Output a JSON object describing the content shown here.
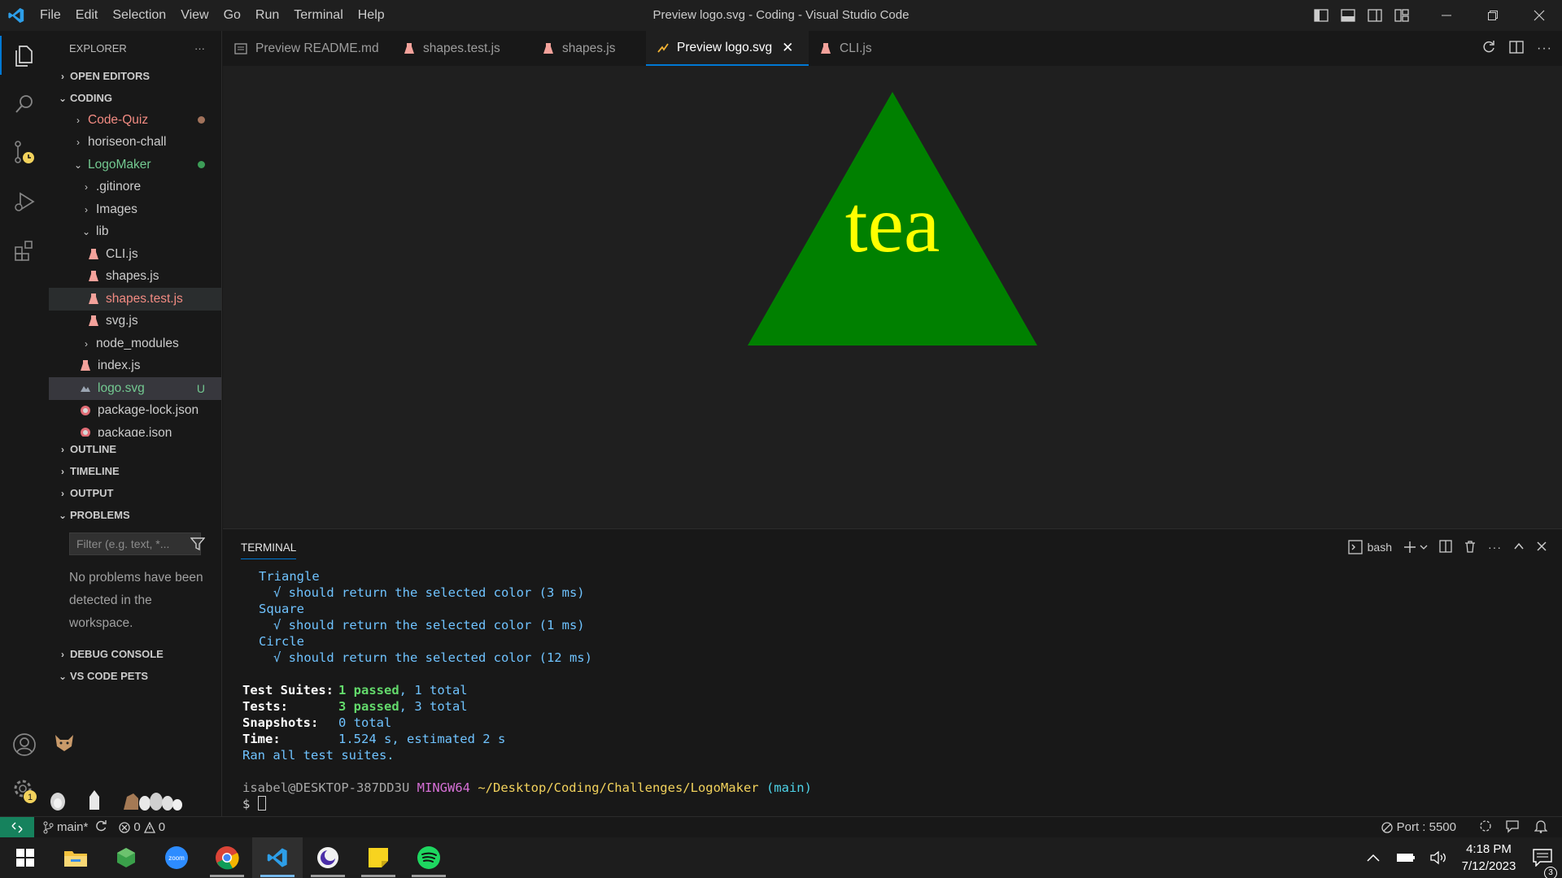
{
  "window": {
    "title": "Preview logo.svg - Coding - Visual Studio Code",
    "menu": [
      "File",
      "Edit",
      "Selection",
      "View",
      "Go",
      "Run",
      "Terminal",
      "Help"
    ]
  },
  "sidebar": {
    "explorer_label": "EXPLORER",
    "more": "···",
    "open_editors": "OPEN EDITORS",
    "workspace": "CODING",
    "tree": {
      "code_quiz": "Code-Quiz",
      "horiseon": "horiseon-chall",
      "logomaker": "LogoMaker",
      "gitignore": ".gitinore",
      "images": "Images",
      "lib": "lib",
      "cli": "CLI.js",
      "shapes": "shapes.js",
      "shapes_test": "shapes.test.js",
      "svg": "svg.js",
      "node_modules": "node_modules",
      "index": "index.js",
      "logo": "logo.svg",
      "logo_flag": "U",
      "package_lock": "package-lock.json",
      "package": "package.json"
    },
    "outline": "OUTLINE",
    "timeline": "TIMELINE",
    "output": "OUTPUT",
    "problems": "PROBLEMS",
    "filter_placeholder": "Filter (e.g. text, *...",
    "no_problems": "No problems have been detected in the workspace.",
    "debug_console": "DEBUG CONSOLE",
    "vscode_pets": "VS CODE PETS"
  },
  "tabs": [
    {
      "label": "Preview README.md"
    },
    {
      "label": "shapes.test.js"
    },
    {
      "label": "shapes.js"
    },
    {
      "label": "Preview logo.svg"
    },
    {
      "label": "CLI.js"
    }
  ],
  "preview": {
    "text": "tea",
    "shape_color": "#008000",
    "text_color": "#ffff00"
  },
  "panel": {
    "tab": "TERMINAL",
    "shell": "bash",
    "lines": {
      "l1": "Triangle",
      "l2": "√ should return the selected color (3 ms)",
      "l3": "Square",
      "l4": "√ should return the selected color (1 ms)",
      "l5": "Circle",
      "l6": "√ should return the selected color (12 ms)",
      "suites_label": "Test Suites:",
      "suites_pass": "1 passed",
      "suites_total": ", 1 total",
      "tests_label": "Tests:",
      "tests_pass": "3 passed",
      "tests_total": ", 3 total",
      "snap_label": "Snapshots:",
      "snap_val": "0 total",
      "time_label": "Time:",
      "time_val": "1.524 s, estimated 2 s",
      "ran": "Ran all test suites.",
      "prompt_user": "isabel@DESKTOP-387DD3U",
      "prompt_env": "MINGW64",
      "prompt_path": "~/Desktop/Coding/Challenges/LogoMaker",
      "prompt_branch": "(main)",
      "prompt_sign": "$"
    }
  },
  "statusbar": {
    "branch": "main*",
    "errors": "0",
    "warnings": "0",
    "port": "Port : 5500",
    "settings_badge": "1"
  },
  "taskbar": {
    "time": "4:18 PM",
    "date": "7/12/2023",
    "notifications": "3",
    "zoom_label": "zoom"
  },
  "colors": {
    "accent": "#0078d4",
    "modified_dot": "#a1725b",
    "added_dot": "#3c9d57",
    "error_red": "#f28b82"
  }
}
